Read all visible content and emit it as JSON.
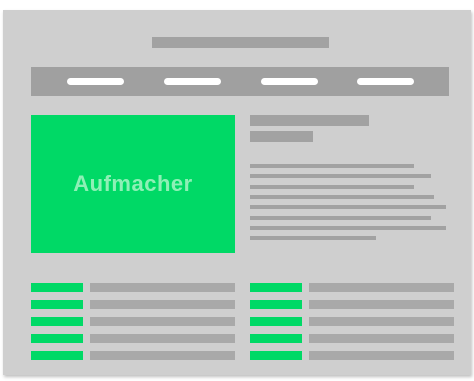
{
  "hero": {
    "label": "Aufmacher"
  },
  "colors": {
    "accent": "#00d966",
    "frame": "#cfcfcf",
    "placeholder": "#a2a2a2",
    "nav_item": "#ffffff"
  }
}
